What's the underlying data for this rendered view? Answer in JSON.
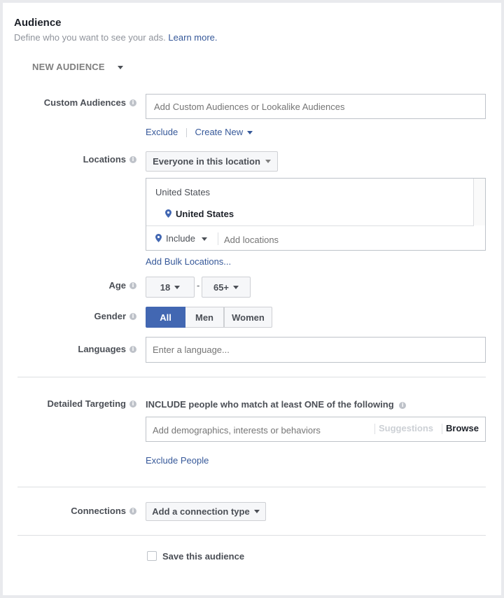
{
  "header": {
    "title": "Audience",
    "subtitle": "Define who you want to see your ads.",
    "learn_more": "Learn more."
  },
  "audience_dropdown": {
    "label": "NEW AUDIENCE"
  },
  "custom_audiences": {
    "label": "Custom Audiences",
    "placeholder": "Add Custom Audiences or Lookalike Audiences",
    "exclude": "Exclude",
    "create_new": "Create New"
  },
  "locations": {
    "label": "Locations",
    "scope_dropdown": "Everyone in this location",
    "group_header": "United States",
    "selected": "United States",
    "mode_dropdown": "Include",
    "add_placeholder": "Add locations",
    "bulk_link": "Add Bulk Locations..."
  },
  "age": {
    "label": "Age",
    "min": "18",
    "separator": "-",
    "max": "65+"
  },
  "gender": {
    "label": "Gender",
    "options": [
      "All",
      "Men",
      "Women"
    ],
    "selected": "All"
  },
  "languages": {
    "label": "Languages",
    "placeholder": "Enter a language..."
  },
  "detailed_targeting": {
    "label": "Detailed Targeting",
    "include_text": "INCLUDE people who match at least ONE of the following",
    "placeholder": "Add demographics, interests or behaviors",
    "suggestions": "Suggestions",
    "browse": "Browse",
    "exclude_link": "Exclude People"
  },
  "connections": {
    "label": "Connections",
    "dropdown": "Add a connection type"
  },
  "save": {
    "label": "Save this audience",
    "checked": false
  },
  "colors": {
    "accent": "#4267b2",
    "link": "#365899",
    "border": "#bec3c9"
  }
}
